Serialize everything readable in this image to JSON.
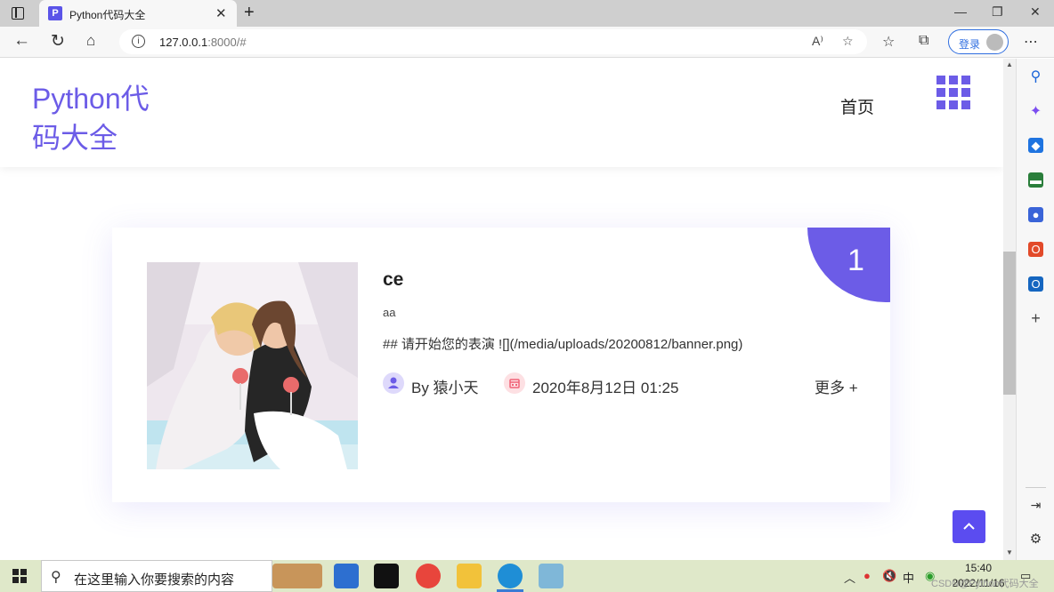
{
  "browser": {
    "tab_title": "Python代码大全",
    "tab_favicon_letter": "P",
    "url_host": "127.0.0.1",
    "url_rest": ":8000/#",
    "login_label": "登录"
  },
  "site": {
    "logo": "Python代码大全",
    "nav_home": "首页",
    "accent": "#6c5ce7"
  },
  "post": {
    "rank": "1",
    "title": "ce",
    "subtitle": "aa",
    "body": "## 请开始您的表演 ![](/media/uploads/20200812/banner.png)",
    "author": "By 猿小天",
    "date": "2020年8月12日 01:25",
    "more": "更多 +"
  },
  "taskbar": {
    "search_placeholder": "在这里输入你要搜索的内容",
    "time": "15:40",
    "date": "2022/11/16",
    "watermark": "CSDN@Python代码大全",
    "ime": "中"
  }
}
